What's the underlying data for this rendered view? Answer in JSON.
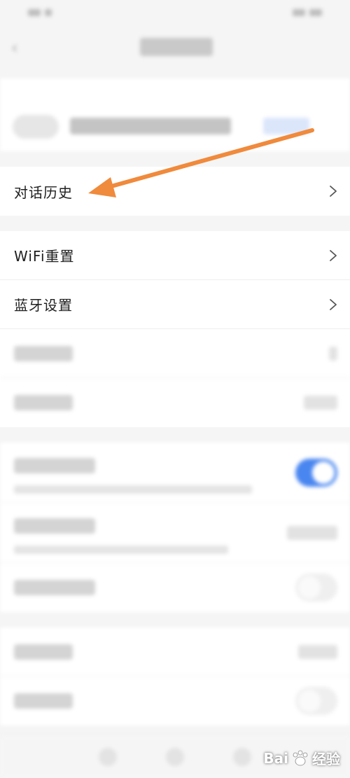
{
  "rows": {
    "history": {
      "label": "对话历史"
    },
    "wifi": {
      "label": "WiFi重置"
    },
    "bluetooth": {
      "label": "蓝牙设置"
    }
  },
  "icons": {
    "chevron": "chevron-right-icon",
    "back": "back-arrow-icon",
    "annotation": "orange-arrow"
  },
  "colors": {
    "annotation_arrow": "#f08a3c",
    "toggle_on": "#4a86f0",
    "card_bg": "#ffffff",
    "page_bg": "#f5f5f5"
  },
  "watermark": {
    "brand": "Bai",
    "brand_suffix": "经验"
  }
}
